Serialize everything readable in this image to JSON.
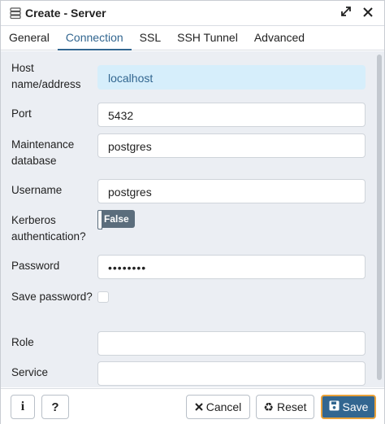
{
  "window": {
    "title": "Create - Server"
  },
  "tabs": [
    {
      "label": "General",
      "active": false
    },
    {
      "label": "Connection",
      "active": true
    },
    {
      "label": "SSL",
      "active": false
    },
    {
      "label": "SSH Tunnel",
      "active": false
    },
    {
      "label": "Advanced",
      "active": false
    }
  ],
  "form": {
    "host": {
      "label": "Host name/address",
      "value": "localhost"
    },
    "port": {
      "label": "Port",
      "value": "5432"
    },
    "maintenance_db": {
      "label": "Maintenance database",
      "value": "postgres"
    },
    "username": {
      "label": "Username",
      "value": "postgres"
    },
    "kerberos": {
      "label": "Kerberos authentication?",
      "value": "False"
    },
    "password": {
      "label": "Password",
      "value": "••••••••"
    },
    "save_password": {
      "label": "Save password?",
      "checked": false
    },
    "role": {
      "label": "Role",
      "value": ""
    },
    "service": {
      "label": "Service",
      "value": ""
    }
  },
  "footer": {
    "info_label": "i",
    "help_label": "?",
    "cancel_label": "Cancel",
    "reset_label": "Reset",
    "save_label": "Save"
  },
  "colors": {
    "accent": "#326690",
    "focus_bg": "#d6eefb",
    "toggle_bg": "#5b6d7c",
    "save_border": "#e8a13a"
  }
}
